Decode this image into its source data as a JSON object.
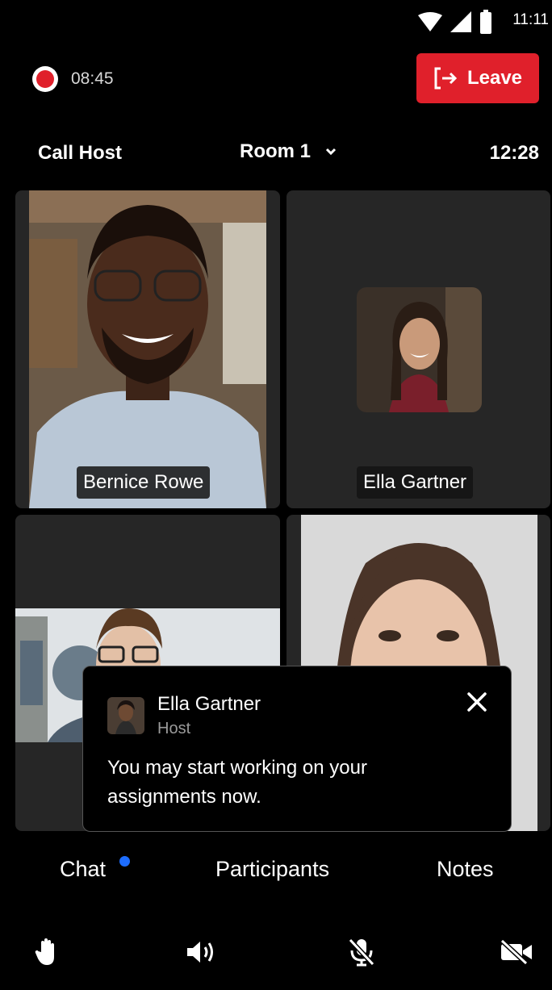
{
  "status_bar": {
    "time": "11:11",
    "icons": [
      "wifi-icon",
      "signal-icon",
      "battery-icon"
    ]
  },
  "recording": {
    "time": "08:45",
    "indicator_color": "#e0202b"
  },
  "leave_button": {
    "label": "Leave",
    "color": "#e0202b",
    "icon": "exit-icon"
  },
  "header": {
    "left_label": "Call Host",
    "room": "Room 1",
    "timer": "12:28"
  },
  "participants": [
    {
      "name": "Bernice Rowe",
      "video": true
    },
    {
      "name": "Ella Gartner",
      "video": false
    },
    {
      "name": "",
      "video": true
    },
    {
      "name": "",
      "video": true
    }
  ],
  "notification": {
    "sender": "Ella Gartner",
    "role": "Host",
    "message": "You may start working on your assignments now."
  },
  "tabs": [
    {
      "label": "Chat",
      "unread": true
    },
    {
      "label": "Participants"
    },
    {
      "label": "Notes"
    }
  ],
  "toolbar": [
    "raise-hand-icon",
    "speaker-icon",
    "mic-off-icon",
    "video-off-icon"
  ],
  "colors": {
    "accent_red": "#e0202b",
    "unread_dot": "#1d6dff",
    "tile_bg": "#262626"
  }
}
